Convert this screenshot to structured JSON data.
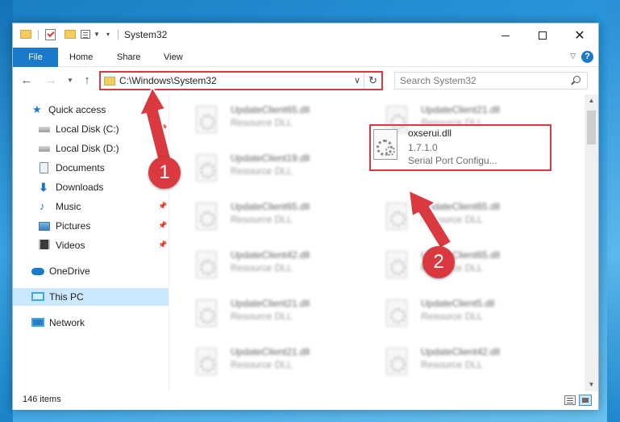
{
  "window": {
    "title": "System32",
    "controls": {
      "minimize": "minimize",
      "maximize": "maximize",
      "close": "✕"
    }
  },
  "ribbon": {
    "tabs": [
      {
        "label": "File"
      },
      {
        "label": "Home"
      },
      {
        "label": "Share"
      },
      {
        "label": "View"
      }
    ],
    "help": "?"
  },
  "nav": {
    "address": "C:\\Windows\\System32",
    "search_placeholder": "Search System32"
  },
  "sidebar": {
    "items": [
      {
        "label": "Quick access",
        "icon": "star-icon",
        "pinned": false
      },
      {
        "label": "Local Disk (C:)",
        "icon": "drive-icon",
        "pinned": true
      },
      {
        "label": "Local Disk (D:)",
        "icon": "drive-icon",
        "pinned": true
      },
      {
        "label": "Documents",
        "icon": "documents-icon",
        "pinned": true
      },
      {
        "label": "Downloads",
        "icon": "download-icon",
        "pinned": true
      },
      {
        "label": "Music",
        "icon": "music-icon",
        "pinned": true
      },
      {
        "label": "Pictures",
        "icon": "pictures-icon",
        "pinned": true
      },
      {
        "label": "Videos",
        "icon": "videos-icon",
        "pinned": true
      },
      {
        "label": "OneDrive",
        "icon": "onedrive-icon",
        "pinned": false
      },
      {
        "label": "This PC",
        "icon": "pc-icon",
        "pinned": false,
        "selected": true
      },
      {
        "label": "Network",
        "icon": "network-icon",
        "pinned": false
      }
    ]
  },
  "files": {
    "left_column": [
      {
        "name": "UpdateClient65.dll",
        "type": "Resource DLL"
      },
      {
        "name": "UpdateClient19.dll",
        "type": "Resource DLL"
      },
      {
        "name": "UpdateClient65.dll",
        "type": "Resource DLL"
      },
      {
        "name": "UpdateClient42.dll",
        "type": "Resource DLL"
      },
      {
        "name": "UpdateClient21.dll",
        "type": "Resource DLL"
      },
      {
        "name": "UpdateClient21.dll",
        "type": "Resource DLL"
      }
    ],
    "right_column": [
      {
        "name": "UpdateClient21.dll",
        "type": "Resource DLL"
      },
      {
        "name": "UpdateClient65.dll",
        "type": "Resource DLL"
      },
      {
        "name": "UpdateClient65.dll",
        "type": "Resource DLL"
      },
      {
        "name": "UpdateClient5.dll",
        "type": "Resource DLL"
      },
      {
        "name": "UpdateClient42.dll",
        "type": "Resource DLL"
      }
    ],
    "highlighted": {
      "name": "oxserui.dll",
      "version": "1.7.1.0",
      "description": "Serial Port Configu..."
    }
  },
  "status": {
    "item_count": "146 items"
  },
  "annotations": {
    "badge_1": "1",
    "badge_2": "2",
    "color": "#d9393f"
  }
}
